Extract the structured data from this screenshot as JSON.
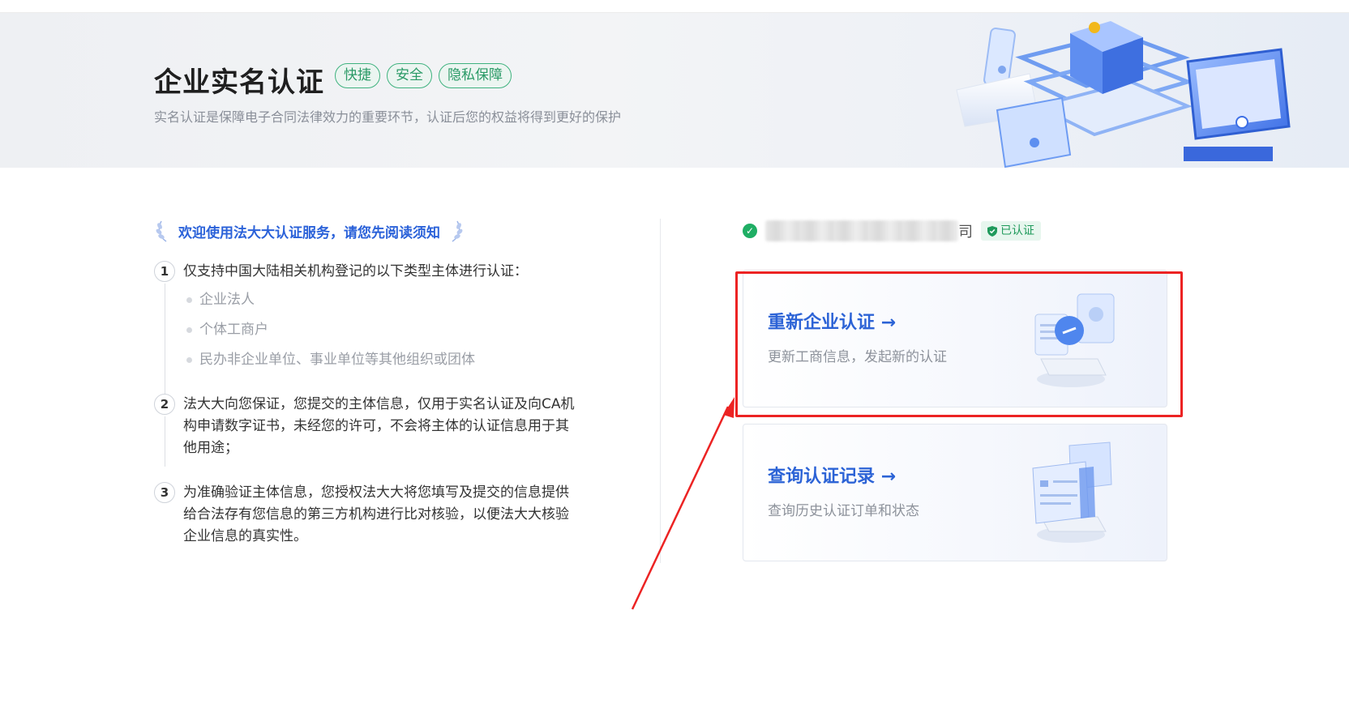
{
  "banner": {
    "title": "企业实名认证",
    "tags": [
      "快捷",
      "安全",
      "隐私保障"
    ],
    "subtitle": "实名认证是保障电子合同法律效力的重要环节，认证后您的权益将得到更好的保护"
  },
  "notice": {
    "welcome": "欢迎使用法大大认证服务，请您先阅读须知",
    "rules": [
      {
        "num": "1",
        "text": "仅支持中国大陆相关机构登记的以下类型主体进行认证："
      },
      {
        "num": "2",
        "text": "法大大向您保证，您提交的主体信息，仅用于实名认证及向CA机构申请数字证书，未经您的许可，不会将主体的认证信息用于其他用途；"
      },
      {
        "num": "3",
        "text": "为准确验证主体信息，您授权法大大将您填写及提交的信息提供给合法存有您信息的第三方机构进行比对核验，以便法大大核验企业信息的真实性。"
      }
    ],
    "entity_types": [
      "企业法人",
      "个体工商户",
      "民办非企业单位、事业单位等其他组织或团体"
    ]
  },
  "company": {
    "name_tail": "司",
    "status_badge": "已认证"
  },
  "cards": {
    "recertify": {
      "title": "重新企业认证 →",
      "desc": "更新工商信息，发起新的认证"
    },
    "records": {
      "title": "查询认证记录 →",
      "desc": "查询历史认证订单和状态"
    }
  },
  "colors": {
    "accent": "#2c63d6",
    "tag_green": "#2a9a66",
    "success": "#1fae64",
    "annotation_red": "#ec2323"
  }
}
